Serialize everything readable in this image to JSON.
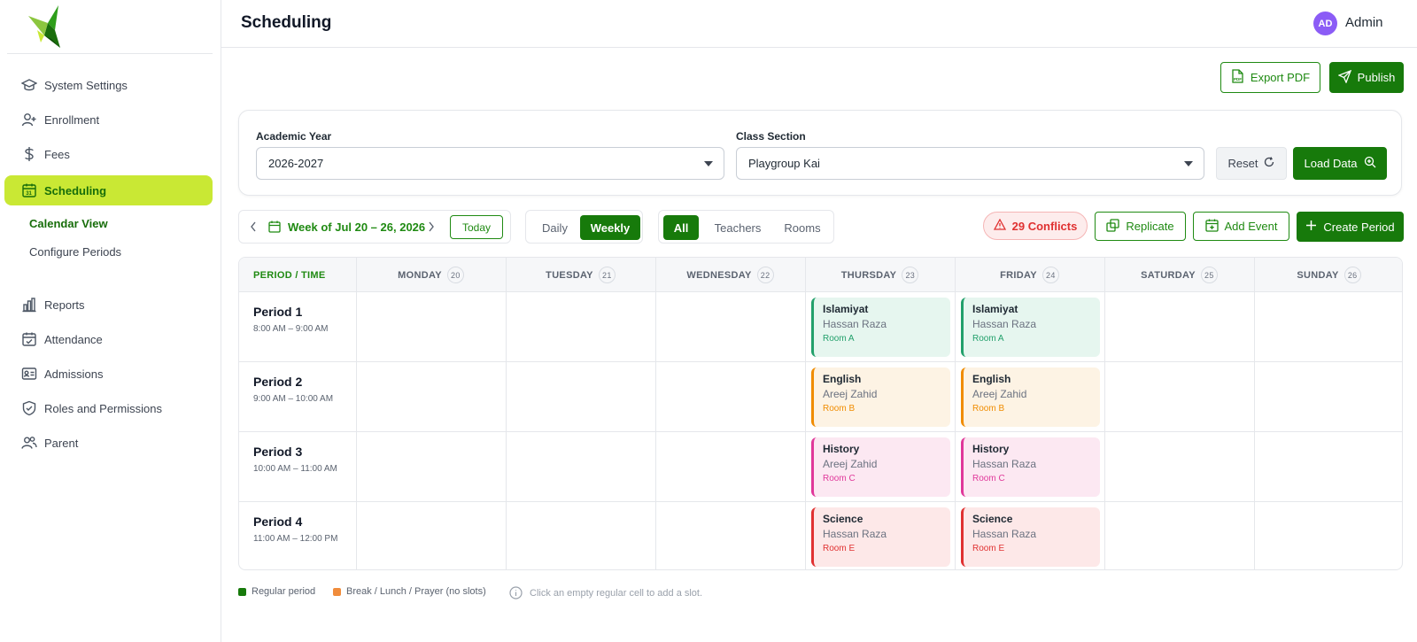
{
  "header": {
    "title": "Scheduling",
    "user_initials": "AD",
    "user_name": "Admin"
  },
  "sidebar": {
    "items": [
      {
        "label": "System Settings"
      },
      {
        "label": "Enrollment"
      },
      {
        "label": "Fees"
      },
      {
        "label": "Scheduling"
      },
      {
        "label": "Reports"
      },
      {
        "label": "Attendance"
      },
      {
        "label": "Admissions"
      },
      {
        "label": "Roles and Permissions"
      },
      {
        "label": "Parent"
      }
    ],
    "subitems": [
      {
        "label": "Calendar View"
      },
      {
        "label": "Configure Periods"
      }
    ]
  },
  "actions": {
    "export_label": "Export PDF",
    "publish_label": "Publish"
  },
  "filters": {
    "academic_year_label": "Academic Year",
    "academic_year_value": "2026-2027",
    "class_section_label": "Class Section",
    "class_section_value": "Playgroup Kai",
    "reset_label": "Reset",
    "load_label": "Load Data"
  },
  "toolbar": {
    "week_label": "Week of Jul 20 – 26, 2026",
    "today_label": "Today",
    "views": [
      "Daily",
      "Weekly"
    ],
    "active_view": "Weekly",
    "types": [
      "All",
      "Teachers",
      "Rooms"
    ],
    "active_type": "All",
    "conflicts_label": "29 Conflicts",
    "replicate_label": "Replicate",
    "add_event_label": "Add Event",
    "create_period_label": "Create Period"
  },
  "grid": {
    "corner_label": "PERIOD / TIME",
    "days": [
      {
        "name": "MONDAY",
        "num": "20"
      },
      {
        "name": "TUESDAY",
        "num": "21"
      },
      {
        "name": "WEDNESDAY",
        "num": "22"
      },
      {
        "name": "THURSDAY",
        "num": "23"
      },
      {
        "name": "FRIDAY",
        "num": "24"
      },
      {
        "name": "SATURDAY",
        "num": "25"
      },
      {
        "name": "SUNDAY",
        "num": "26"
      }
    ],
    "periods": [
      {
        "name": "Period 1",
        "time": "8:00 AM – 9:00 AM"
      },
      {
        "name": "Period 2",
        "time": "9:00 AM – 10:00 AM"
      },
      {
        "name": "Period 3",
        "time": "10:00 AM – 11:00 AM"
      },
      {
        "name": "Period 4",
        "time": "11:00 AM – 12:00 PM"
      }
    ],
    "slots": [
      {
        "period": 0,
        "day": 3,
        "subject": "Islamiyat",
        "teacher": "Hassan Raza",
        "room": "Room A",
        "color": "#22a06b",
        "bg": "#e6f6ef"
      },
      {
        "period": 0,
        "day": 4,
        "subject": "Islamiyat",
        "teacher": "Hassan Raza",
        "room": "Room A",
        "color": "#22a06b",
        "bg": "#e6f6ef"
      },
      {
        "period": 1,
        "day": 3,
        "subject": "English",
        "teacher": "Areej Zahid",
        "room": "Room B",
        "color": "#f08c00",
        "bg": "#fdf3e4"
      },
      {
        "period": 1,
        "day": 4,
        "subject": "English",
        "teacher": "Areej Zahid",
        "room": "Room B",
        "color": "#f08c00",
        "bg": "#fdf3e4"
      },
      {
        "period": 2,
        "day": 3,
        "subject": "History",
        "teacher": "Areej Zahid",
        "room": "Room C",
        "color": "#e0379a",
        "bg": "#fce8f2"
      },
      {
        "period": 2,
        "day": 4,
        "subject": "History",
        "teacher": "Hassan Raza",
        "room": "Room C",
        "color": "#e0379a",
        "bg": "#fce8f2"
      },
      {
        "period": 3,
        "day": 3,
        "subject": "Science",
        "teacher": "Hassan Raza",
        "room": "Room E",
        "color": "#e03131",
        "bg": "#fde8e8"
      },
      {
        "period": 3,
        "day": 4,
        "subject": "Science",
        "teacher": "Hassan Raza",
        "room": "Room E",
        "color": "#e03131",
        "bg": "#fde8e8"
      }
    ]
  },
  "legend": {
    "regular": "Regular period",
    "break": "Break / Lunch / Prayer (no slots)",
    "hint": "Click an empty regular cell to add a slot."
  },
  "colors": {
    "accent": "#177a0b",
    "active_nav": "#c9e834",
    "conflict": "#e03131",
    "avatar": "#8b5cf6",
    "break": "#f08c3c"
  }
}
